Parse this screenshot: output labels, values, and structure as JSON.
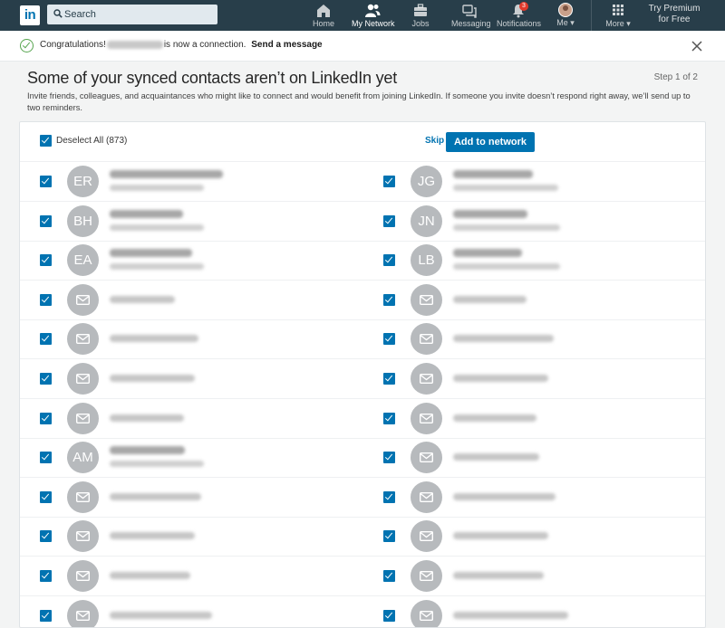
{
  "nav": {
    "logo": "in",
    "search_placeholder": "Search",
    "items": [
      {
        "label": "Home"
      },
      {
        "label": "My Network"
      },
      {
        "label": "Jobs"
      },
      {
        "label": "Messaging"
      },
      {
        "label": "Notifications",
        "badge": "3"
      },
      {
        "label": "Me ▾"
      },
      {
        "label": "More ▾"
      }
    ],
    "premium_line1": "Try Premium",
    "premium_line2": "for Free"
  },
  "congrats": {
    "prefix": "Congratulations!",
    "suffix": "is now a connection.",
    "link": "Send a message"
  },
  "page": {
    "title": "Some of your synced contacts aren’t on LinkedIn yet",
    "step": "Step 1 of 2",
    "intro": "Invite friends, colleagues, and acquaintances who might like to connect and would benefit from joining LinkedIn. If someone you invite doesn’t respond right away, we’ll send up to two reminders."
  },
  "card": {
    "deselect_label": "Deselect All (873)",
    "skip": "Skip",
    "add_button": "Add to network"
  },
  "contacts": [
    [
      {
        "initials": "ER",
        "named": true
      },
      {
        "initials": "JG",
        "named": true
      }
    ],
    [
      {
        "initials": "BH",
        "named": true
      },
      {
        "initials": "JN",
        "named": true
      }
    ],
    [
      {
        "initials": "EA",
        "named": true
      },
      {
        "initials": "LB",
        "named": true
      }
    ],
    [
      {
        "icon": "mail-icon"
      },
      {
        "icon": "mail-icon"
      }
    ],
    [
      {
        "icon": "mail-icon"
      },
      {
        "icon": "mail-icon"
      }
    ],
    [
      {
        "icon": "mail-icon"
      },
      {
        "icon": "mail-icon"
      }
    ],
    [
      {
        "icon": "mail-icon"
      },
      {
        "icon": "mail-icon"
      }
    ],
    [
      {
        "initials": "AM",
        "named": true
      },
      {
        "icon": "mail-icon"
      }
    ],
    [
      {
        "icon": "mail-icon"
      },
      {
        "icon": "mail-icon"
      }
    ],
    [
      {
        "icon": "mail-icon"
      },
      {
        "icon": "mail-icon"
      }
    ],
    [
      {
        "icon": "mail-icon"
      },
      {
        "icon": "mail-icon"
      }
    ],
    [
      {
        "icon": "mail-icon",
        "named": true
      },
      {
        "icon": "mail-icon",
        "named": true
      }
    ]
  ],
  "colors": {
    "nav_bg": "#283e4a",
    "accent": "#0073b1",
    "success": "#57a54f",
    "badge": "#e0392b"
  }
}
